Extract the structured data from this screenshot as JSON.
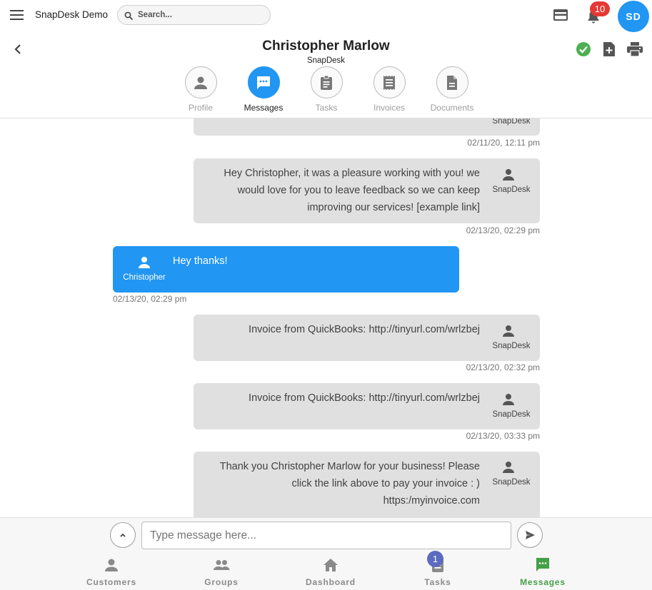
{
  "app": {
    "title": "SnapDesk Demo",
    "search_placeholder": "Search...",
    "notifications_count": "10",
    "avatar_initials": "SD"
  },
  "contact": {
    "name": "Christopher Marlow",
    "company": "SnapDesk",
    "status": "verified"
  },
  "profile_tabs": [
    {
      "label": "Profile",
      "icon": "person-icon",
      "active": false
    },
    {
      "label": "Messages",
      "icon": "chat-icon",
      "active": true
    },
    {
      "label": "Tasks",
      "icon": "clipboard-icon",
      "active": false
    },
    {
      "label": "Invoices",
      "icon": "receipt-icon",
      "active": false
    },
    {
      "label": "Documents",
      "icon": "document-icon",
      "active": false
    }
  ],
  "messages": [
    {
      "direction": "out",
      "text": "",
      "sender": "SnapDesk",
      "timestamp": "02/11/20, 12:11 pm"
    },
    {
      "direction": "out",
      "text": "Hey Christopher, it was a pleasure working with you! we would love for you to leave feedback so we can keep improving our services! [example link]",
      "sender": "SnapDesk",
      "timestamp": "02/13/20, 02:29 pm"
    },
    {
      "direction": "in",
      "text": "Hey thanks!",
      "sender": "Christopher",
      "timestamp": "02/13/20, 02:29 pm"
    },
    {
      "direction": "out",
      "text": "Invoice from QuickBooks: http://tinyurl.com/wrlzbej",
      "sender": "SnapDesk",
      "timestamp": "02/13/20, 02:32 pm"
    },
    {
      "direction": "out",
      "text": "Invoice from QuickBooks: http://tinyurl.com/wrlzbej",
      "sender": "SnapDesk",
      "timestamp": "02/13/20, 03:33 pm"
    },
    {
      "direction": "out",
      "text": "Thank you Christopher Marlow for your business! Please click the link above to pay your invoice : ) https:/myinvoice.com",
      "sender": "SnapDesk",
      "timestamp": ""
    }
  ],
  "composer": {
    "placeholder": "Type message here..."
  },
  "bottom_nav": [
    {
      "label": "Customers",
      "icon": "person-icon",
      "active": false
    },
    {
      "label": "Groups",
      "icon": "group-icon",
      "active": false
    },
    {
      "label": "Dashboard",
      "icon": "home-icon",
      "active": false
    },
    {
      "label": "Tasks",
      "icon": "clipboard-icon",
      "active": false,
      "badge": "1"
    },
    {
      "label": "Messages",
      "icon": "chat-icon",
      "active": true
    }
  ],
  "colors": {
    "accent": "#2196f3",
    "badge_red": "#e53935",
    "active_green": "#43a047",
    "check_green": "#4caf50",
    "task_badge": "#5c6bc0"
  }
}
